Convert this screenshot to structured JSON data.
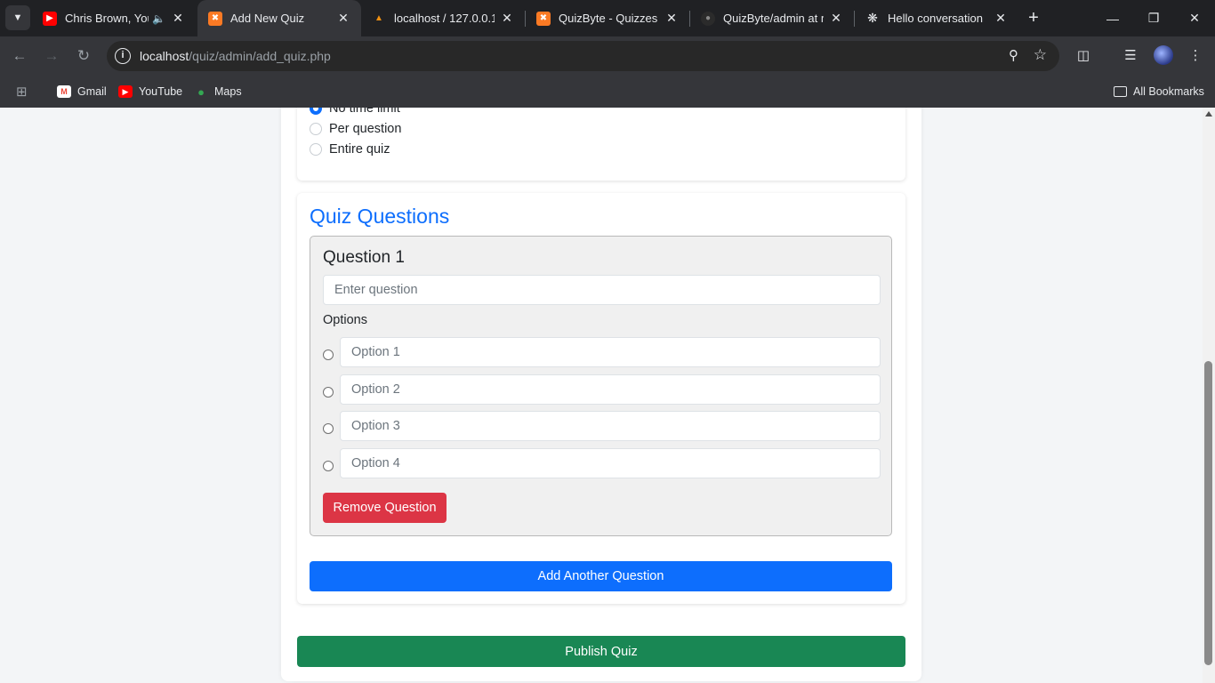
{
  "browser": {
    "tabs": [
      {
        "title": "Chris Brown, Your",
        "icon": "youtube-icon",
        "audio": true,
        "active": false
      },
      {
        "title": "Add New Quiz",
        "icon": "xampp-icon",
        "active": true
      },
      {
        "title": "localhost / 127.0.0.1 /",
        "icon": "phpmyadmin-icon",
        "active": false
      },
      {
        "title": "QuizByte - Quizzes",
        "icon": "xampp-icon",
        "active": false
      },
      {
        "title": "QuizByte/admin at m",
        "icon": "github-icon",
        "active": false
      },
      {
        "title": "Hello conversation",
        "icon": "chatgpt-icon",
        "active": false
      }
    ],
    "url_host": "localhost",
    "url_path": "/quiz/admin/add_quiz.php",
    "bookmarks": [
      {
        "label": "Gmail",
        "icon": "gmail-icon"
      },
      {
        "label": "YouTube",
        "icon": "youtube-icon"
      },
      {
        "label": "Maps",
        "icon": "maps-icon"
      }
    ],
    "all_bookmarks": "All Bookmarks"
  },
  "time_limit": {
    "options": [
      {
        "label": "No time limit",
        "selected": true
      },
      {
        "label": "Per question",
        "selected": false
      },
      {
        "label": "Entire quiz",
        "selected": false
      }
    ]
  },
  "questions_section": {
    "title": "Quiz Questions",
    "question": {
      "title": "Question 1",
      "placeholder": "Enter question",
      "options_label": "Options",
      "options": [
        "Option 1",
        "Option 2",
        "Option 3",
        "Option 4"
      ],
      "remove_label": "Remove Question"
    },
    "add_label": "Add Another Question"
  },
  "publish_label": "Publish Quiz",
  "colors": {
    "primary": "#0d6efd",
    "danger": "#dc3545",
    "success": "#198754"
  }
}
